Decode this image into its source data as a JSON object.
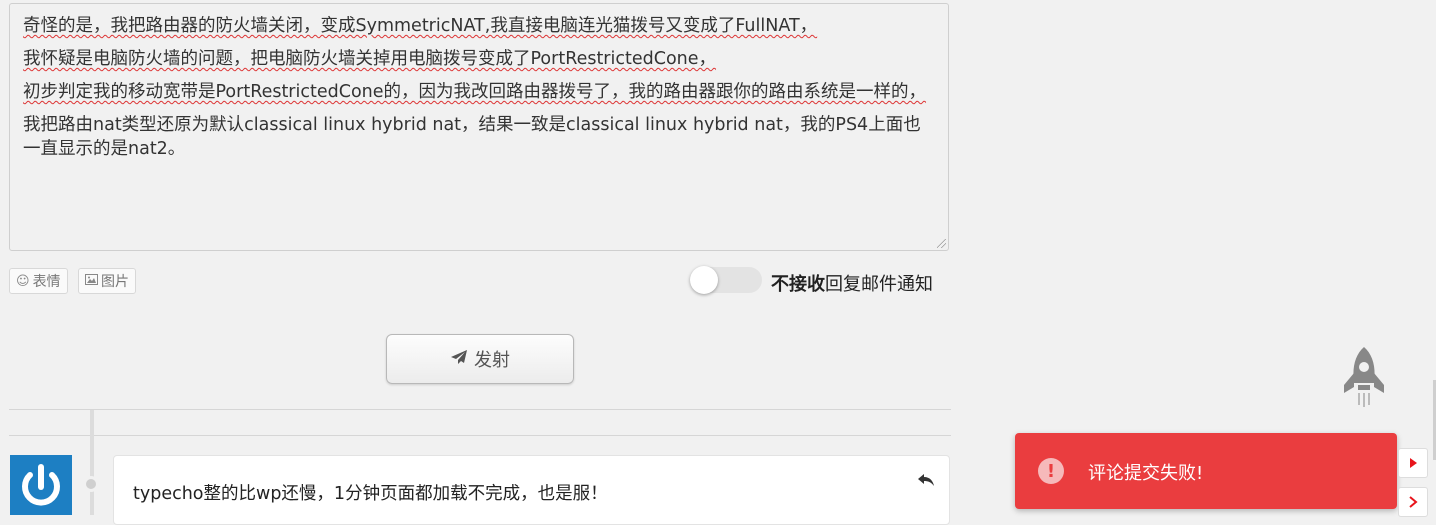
{
  "editor": {
    "paragraphs": [
      "奇怪的是，我把路由器的防火墙关闭，变成SymmetricNAT,我直接电脑连光猫拨号又变成了FullNAT，",
      "我怀疑是电脑防火墙的问题，把电脑防火墙关掉用电脑拨号变成了PortRestrictedCone，",
      "初步判定我的移动宽带是PortRestrictedCone的，因为我改回路由器拨号了，我的路由器跟你的路由系统是一样的，",
      "我把路由nat类型还原为默认classical linux hybrid nat，结果一致是classical linux hybrid nat，我的PS4上面也一直显示的是nat2。"
    ]
  },
  "toolbar": {
    "emoji_label": "表情",
    "image_label": "图片"
  },
  "notify": {
    "bold": "不接收",
    "rest": "回复邮件通知"
  },
  "submit": {
    "label": "发射"
  },
  "comment": {
    "text": "typecho整的比wp还慢，1分钟页面都加载不完成，也是服！"
  },
  "toast": {
    "icon": "!",
    "message": "评论提交失败!"
  },
  "colors": {
    "toast_bg": "#ea3d3f",
    "avatar_bg": "#1d7fc3",
    "arrow_red": "#e8141c"
  }
}
